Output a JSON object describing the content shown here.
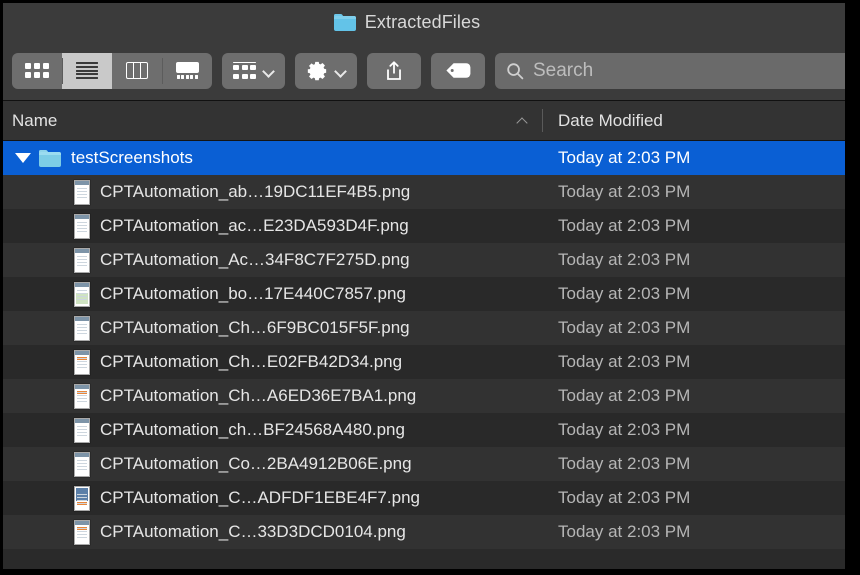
{
  "window": {
    "title": "ExtractedFiles",
    "title_icon": "folder-icon"
  },
  "toolbar": {
    "view_modes": [
      {
        "name": "icon-view",
        "icon": "grid-icon",
        "active": false
      },
      {
        "name": "list-view",
        "icon": "list-icon",
        "active": true
      },
      {
        "name": "column-view",
        "icon": "columns-icon",
        "active": false
      },
      {
        "name": "gallery-view",
        "icon": "gallery-icon",
        "active": false
      }
    ],
    "group_button": {
      "name": "group-by-button",
      "icon": "group-icon",
      "chevron": "chevron-down-icon"
    },
    "action_button": {
      "name": "action-button",
      "icon": "gear-icon",
      "chevron": "chevron-down-icon"
    },
    "share_button": {
      "name": "share-button",
      "icon": "share-icon"
    },
    "tags_button": {
      "name": "tags-button",
      "icon": "tag-icon"
    },
    "search": {
      "placeholder": "Search",
      "value": "",
      "icon": "search-icon"
    }
  },
  "columns": {
    "name": {
      "label": "Name",
      "sort": "ascending",
      "sort_icon": "chevron-up-icon"
    },
    "date_modified": {
      "label": "Date Modified"
    }
  },
  "rows": [
    {
      "kind": "folder",
      "name": "testScreenshots",
      "date": "Today at 2:03 PM",
      "selected": true,
      "expanded": true,
      "thumb": "folder"
    },
    {
      "kind": "file",
      "name": "CPTAutomation_ab…19DC11EF4B5.png",
      "date": "Today at 2:03 PM",
      "selected": false,
      "thumb": "plain"
    },
    {
      "kind": "file",
      "name": "CPTAutomation_ac…E23DA593D4F.png",
      "date": "Today at 2:03 PM",
      "selected": false,
      "thumb": "plain"
    },
    {
      "kind": "file",
      "name": "CPTAutomation_Ac…34F8C7F275D.png",
      "date": "Today at 2:03 PM",
      "selected": false,
      "thumb": "plain"
    },
    {
      "kind": "file",
      "name": "CPTAutomation_bo…17E440C7857.png",
      "date": "Today at 2:03 PM",
      "selected": false,
      "thumb": "green"
    },
    {
      "kind": "file",
      "name": "CPTAutomation_Ch…6F9BC015F5F.png",
      "date": "Today at 2:03 PM",
      "selected": false,
      "thumb": "plain"
    },
    {
      "kind": "file",
      "name": "CPTAutomation_Ch…E02FB42D34.png",
      "date": "Today at 2:03 PM",
      "selected": false,
      "thumb": "orange"
    },
    {
      "kind": "file",
      "name": "CPTAutomation_Ch…A6ED36E7BA1.png",
      "date": "Today at 2:03 PM",
      "selected": false,
      "thumb": "orange"
    },
    {
      "kind": "file",
      "name": "CPTAutomation_ch…BF24568A480.png",
      "date": "Today at 2:03 PM",
      "selected": false,
      "thumb": "plain"
    },
    {
      "kind": "file",
      "name": "CPTAutomation_Co…2BA4912B06E.png",
      "date": "Today at 2:03 PM",
      "selected": false,
      "thumb": "plain"
    },
    {
      "kind": "file",
      "name": "CPTAutomation_C…ADFDF1EBE4F7.png",
      "date": "Today at 2:03 PM",
      "selected": false,
      "thumb": "blue"
    },
    {
      "kind": "file",
      "name": "CPTAutomation_C…33D3DCD0104.png",
      "date": "Today at 2:03 PM",
      "selected": false,
      "thumb": "orange"
    }
  ],
  "colors": {
    "selection": "#0a5fd4",
    "toolbar_bg": "#3b3b3b",
    "list_bg": "#262626",
    "row_alt": "#323232",
    "folder_blue": "#7dcde6"
  }
}
